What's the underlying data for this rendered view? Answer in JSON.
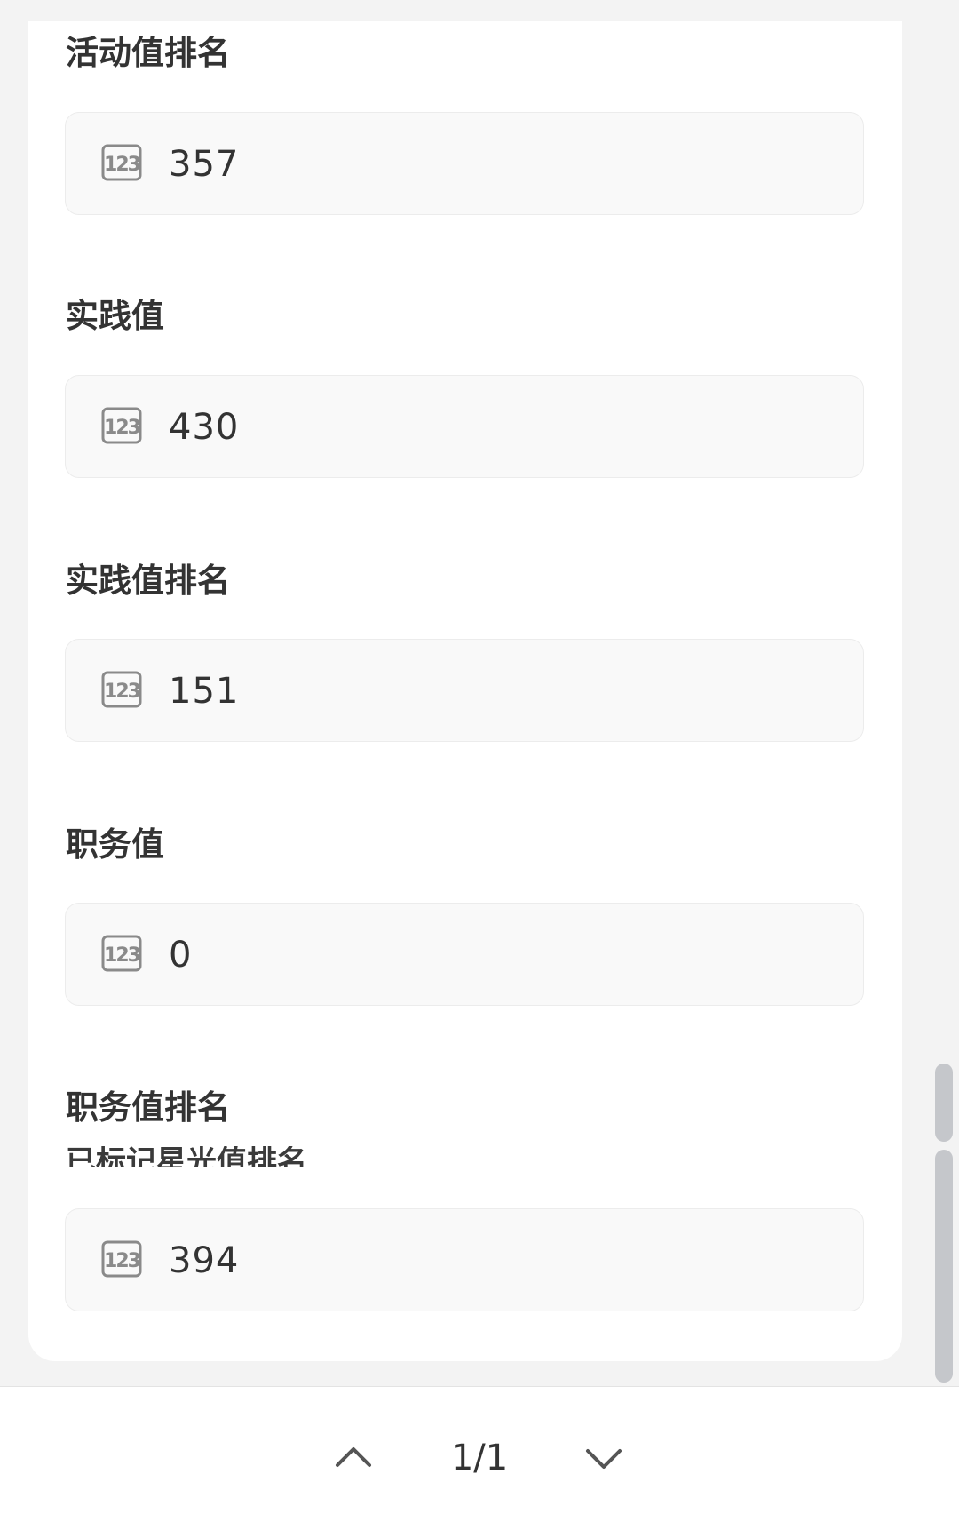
{
  "fields": [
    {
      "label": "活动值排名",
      "value": "357",
      "icon": "number-123-icon"
    },
    {
      "label": "实践值",
      "value": "430",
      "icon": "number-123-icon"
    },
    {
      "label": "实践值排名",
      "value": "151",
      "icon": "number-123-icon"
    },
    {
      "label": "职务值",
      "value": "0",
      "icon": "number-123-icon"
    },
    {
      "label": "职务值排名",
      "overlap_label": "已标记星光值排名",
      "value": "394",
      "icon": "number-123-icon"
    }
  ],
  "pagination": {
    "indicator": "1/1",
    "prev_icon": "chevron-up-icon",
    "next_icon": "chevron-down-icon"
  },
  "colors": {
    "page_bg": "#f3f3f3",
    "card_bg": "#ffffff",
    "field_bg": "#f9f9f9",
    "text": "#333333",
    "scrollbar": "#c5c7cb"
  }
}
